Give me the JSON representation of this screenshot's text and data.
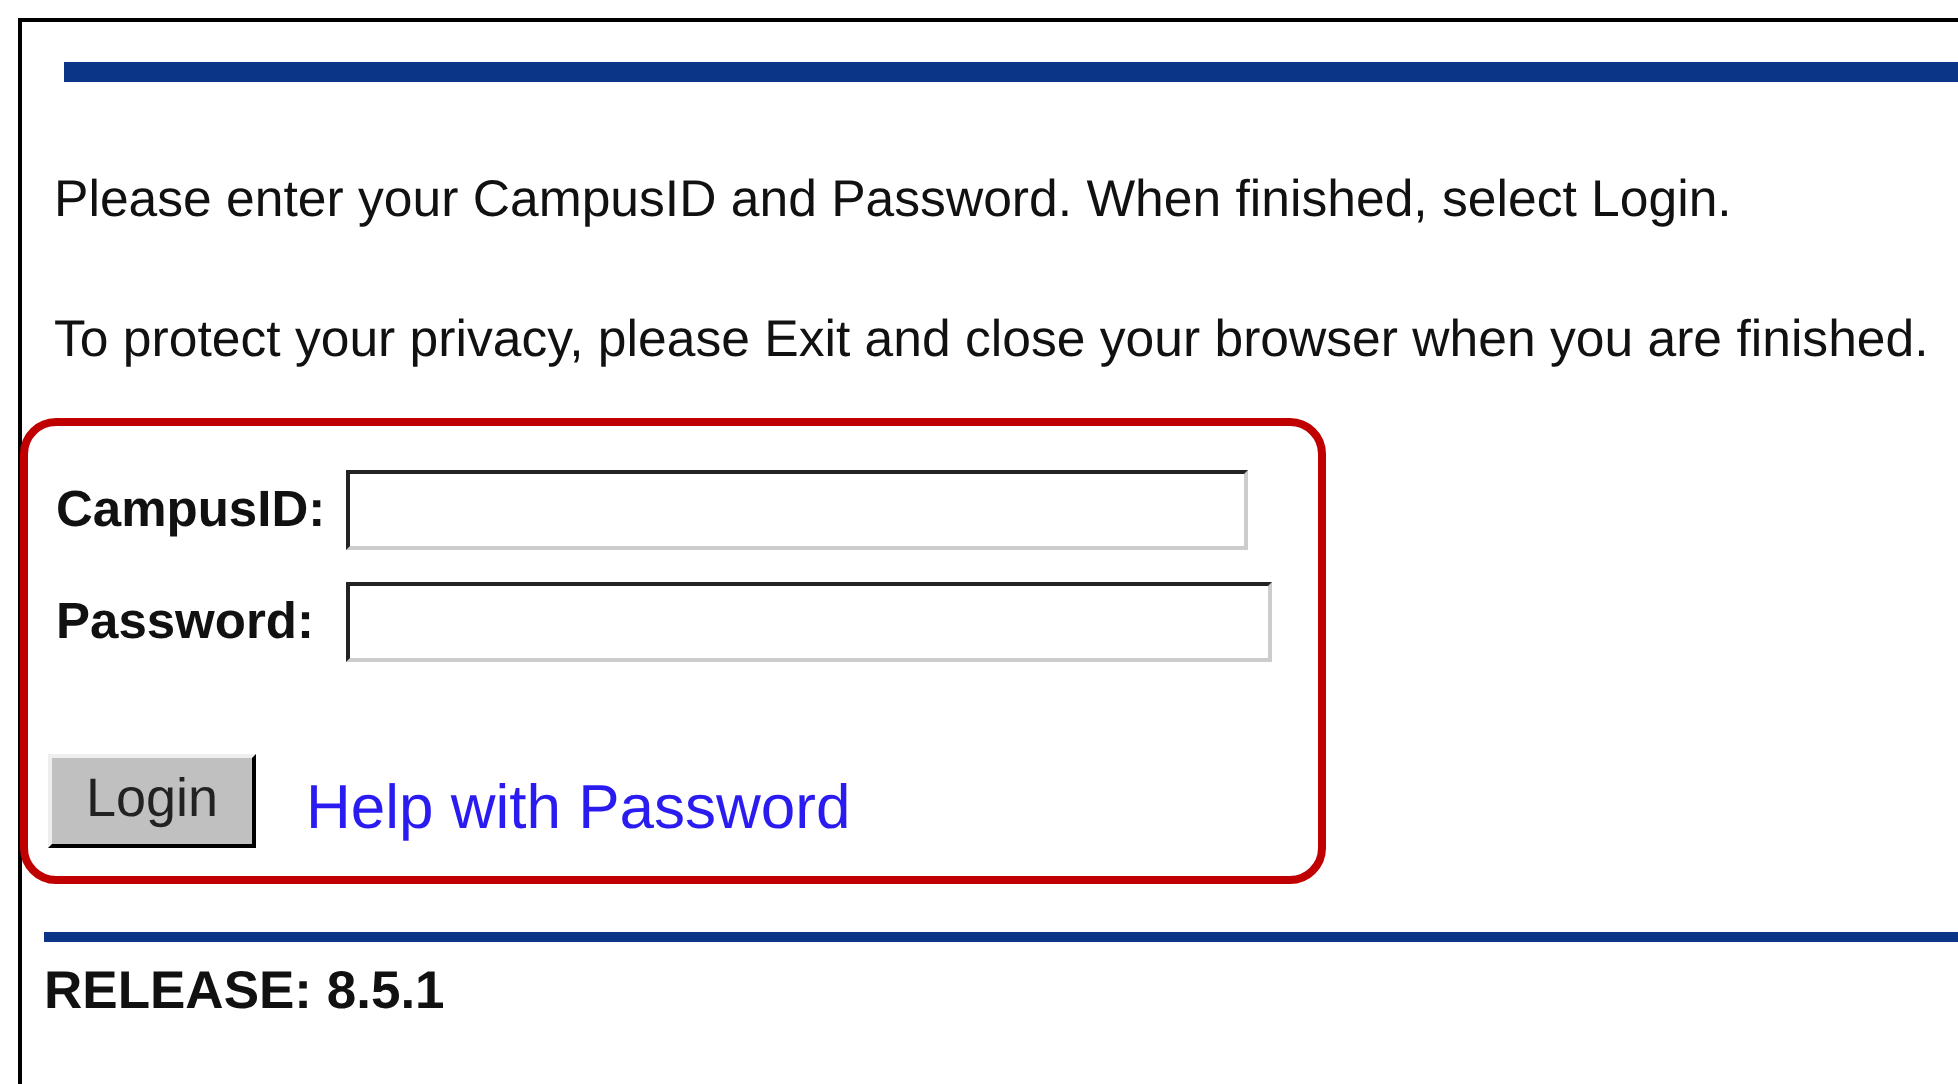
{
  "intro": [
    "Please enter your CampusID and Password. When finished, select Login.",
    "To protect your privacy, please Exit and close your browser when you are finished."
  ],
  "form": {
    "fields": [
      {
        "label": "CampusID:"
      },
      {
        "label": "Password:"
      }
    ],
    "button": "Login",
    "link": "Help with Password"
  },
  "release": "RELEASE: 8.5.1"
}
